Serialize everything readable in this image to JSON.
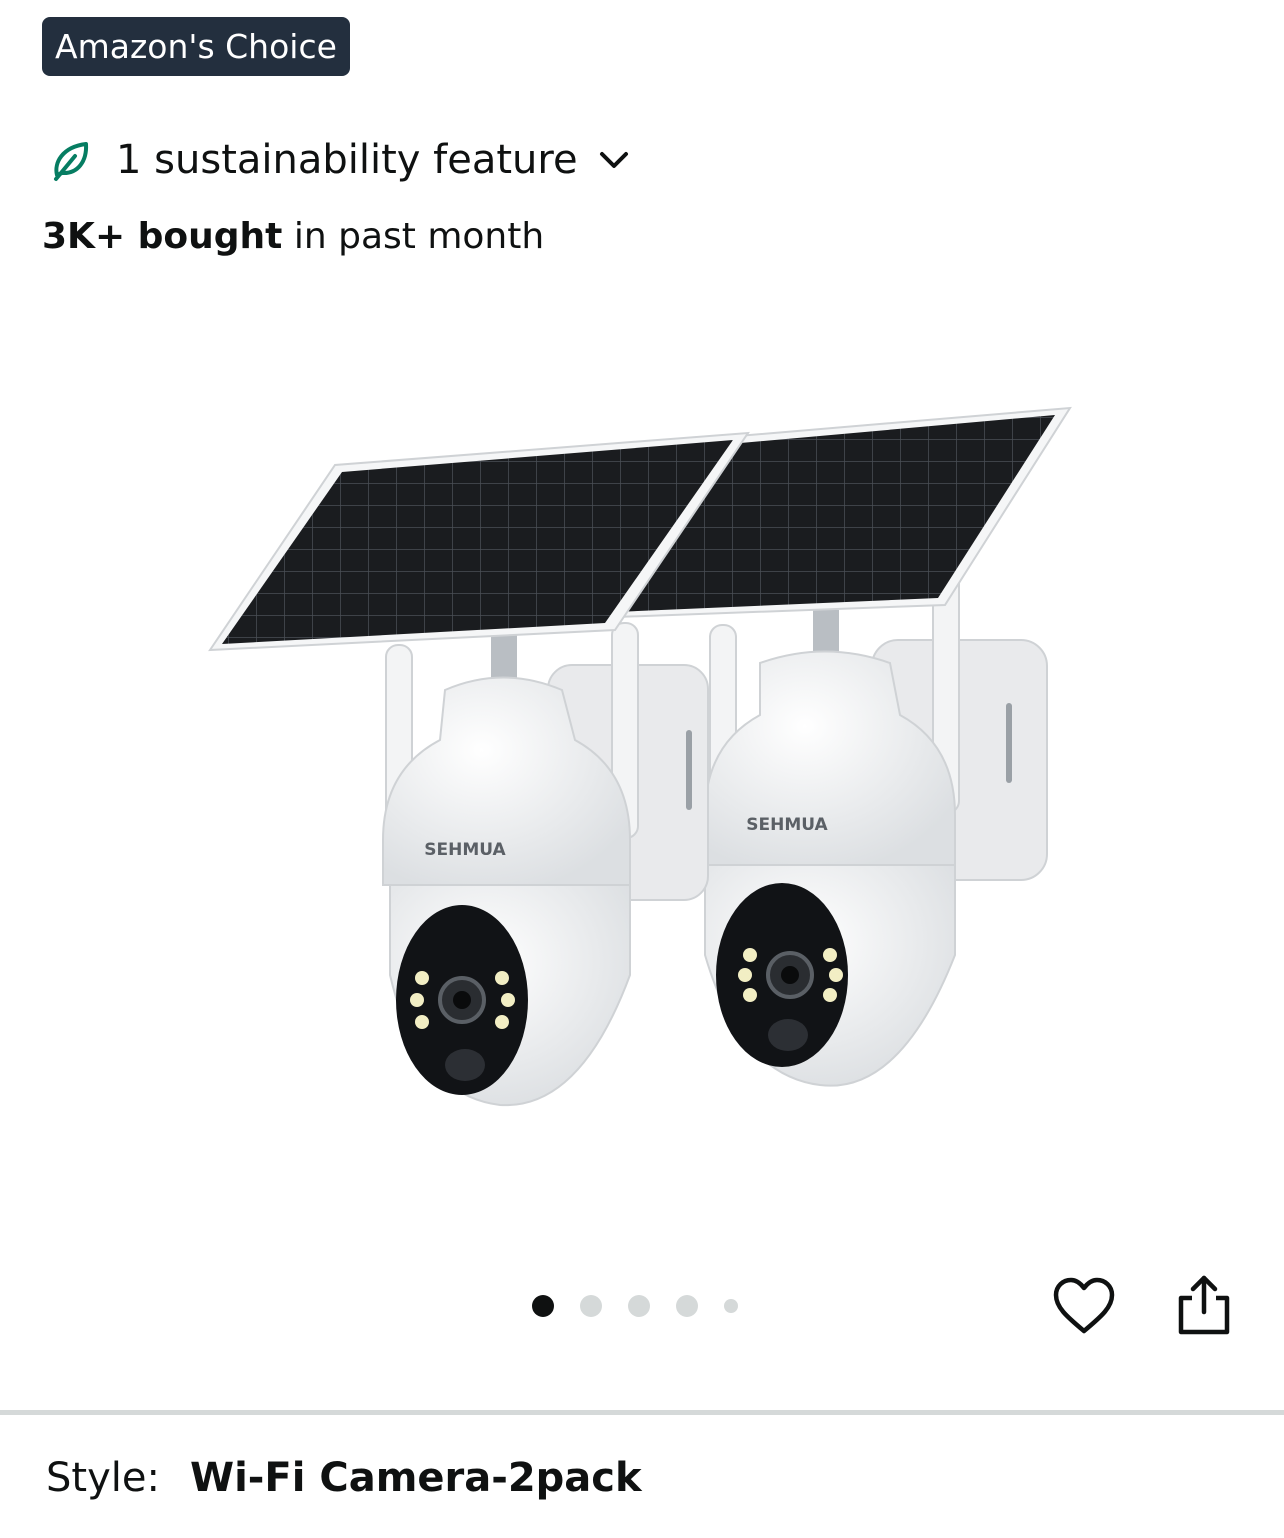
{
  "badge": {
    "text": "Amazon's Choice"
  },
  "sustainability": {
    "label": "1 sustainability feature",
    "icon": "leaf-icon",
    "icon_color": "#067d62"
  },
  "bought": {
    "bold": "3K+ bought",
    "rest": " in past month"
  },
  "product_image": {
    "brand_left": "SEHMUA",
    "brand_right": "SEHMUA"
  },
  "carousel": {
    "total": 5,
    "active_index": 0
  },
  "actions": {
    "wishlist_icon": "heart-icon",
    "share_icon": "share-icon"
  },
  "style": {
    "label": "Style:",
    "value": "Wi-Fi Camera-2pack"
  },
  "colors": {
    "badge_bg": "#232f3e",
    "text": "#0f1111",
    "dot_inactive": "#d5d9d9"
  }
}
